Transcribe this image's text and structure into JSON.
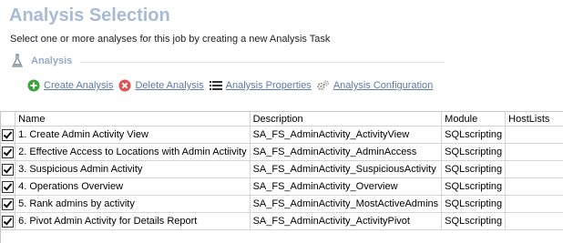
{
  "header": {
    "title": "Analysis Selection",
    "subtitle": "Select one or more analyses for this job by creating a new Analysis Task"
  },
  "section": {
    "label": "Analysis",
    "icon": "flask-icon"
  },
  "toolbar": {
    "create_label": "Create Analysis",
    "delete_label": "Delete Analysis",
    "properties_label": "Analysis Properties",
    "configuration_label": "Analysis Configuration"
  },
  "table": {
    "columns": [
      "Name",
      "Description",
      "Module",
      "HostLists"
    ],
    "rows": [
      {
        "checked": true,
        "name": "1. Create Admin Activity View",
        "description": "SA_FS_AdminActivity_ActivityView",
        "module": "SQLscripting",
        "hostlists": ""
      },
      {
        "checked": true,
        "name": "2. Effective Access to Locations with Admin Actiivity",
        "description": "SA_FS_AdminActivity_AdminAccess",
        "module": "SQLscripting",
        "hostlists": ""
      },
      {
        "checked": true,
        "name": "3. Suspicious Admin Activity",
        "description": "SA_FS_AdminActivity_SuspiciousActivity",
        "module": "SQLscripting",
        "hostlists": ""
      },
      {
        "checked": true,
        "name": "4. Operations Overview",
        "description": "SA_FS_AdminActivity_Overview",
        "module": "SQLscripting",
        "hostlists": ""
      },
      {
        "checked": true,
        "name": "5. Rank admins by activity",
        "description": "SA_FS_AdminActivity_MostActiveAdmins",
        "module": "SQLscripting",
        "hostlists": ""
      },
      {
        "checked": true,
        "name": "6. Pivot Admin Activity for Details Report",
        "description": "SA_FS_AdminActivity_ActivityPivot",
        "module": "SQLscripting",
        "hostlists": ""
      }
    ]
  },
  "colors": {
    "title": "#a7bbd6",
    "link": "#5b7ba8",
    "create_icon": "#3aa63a",
    "delete_icon": "#e05050"
  }
}
